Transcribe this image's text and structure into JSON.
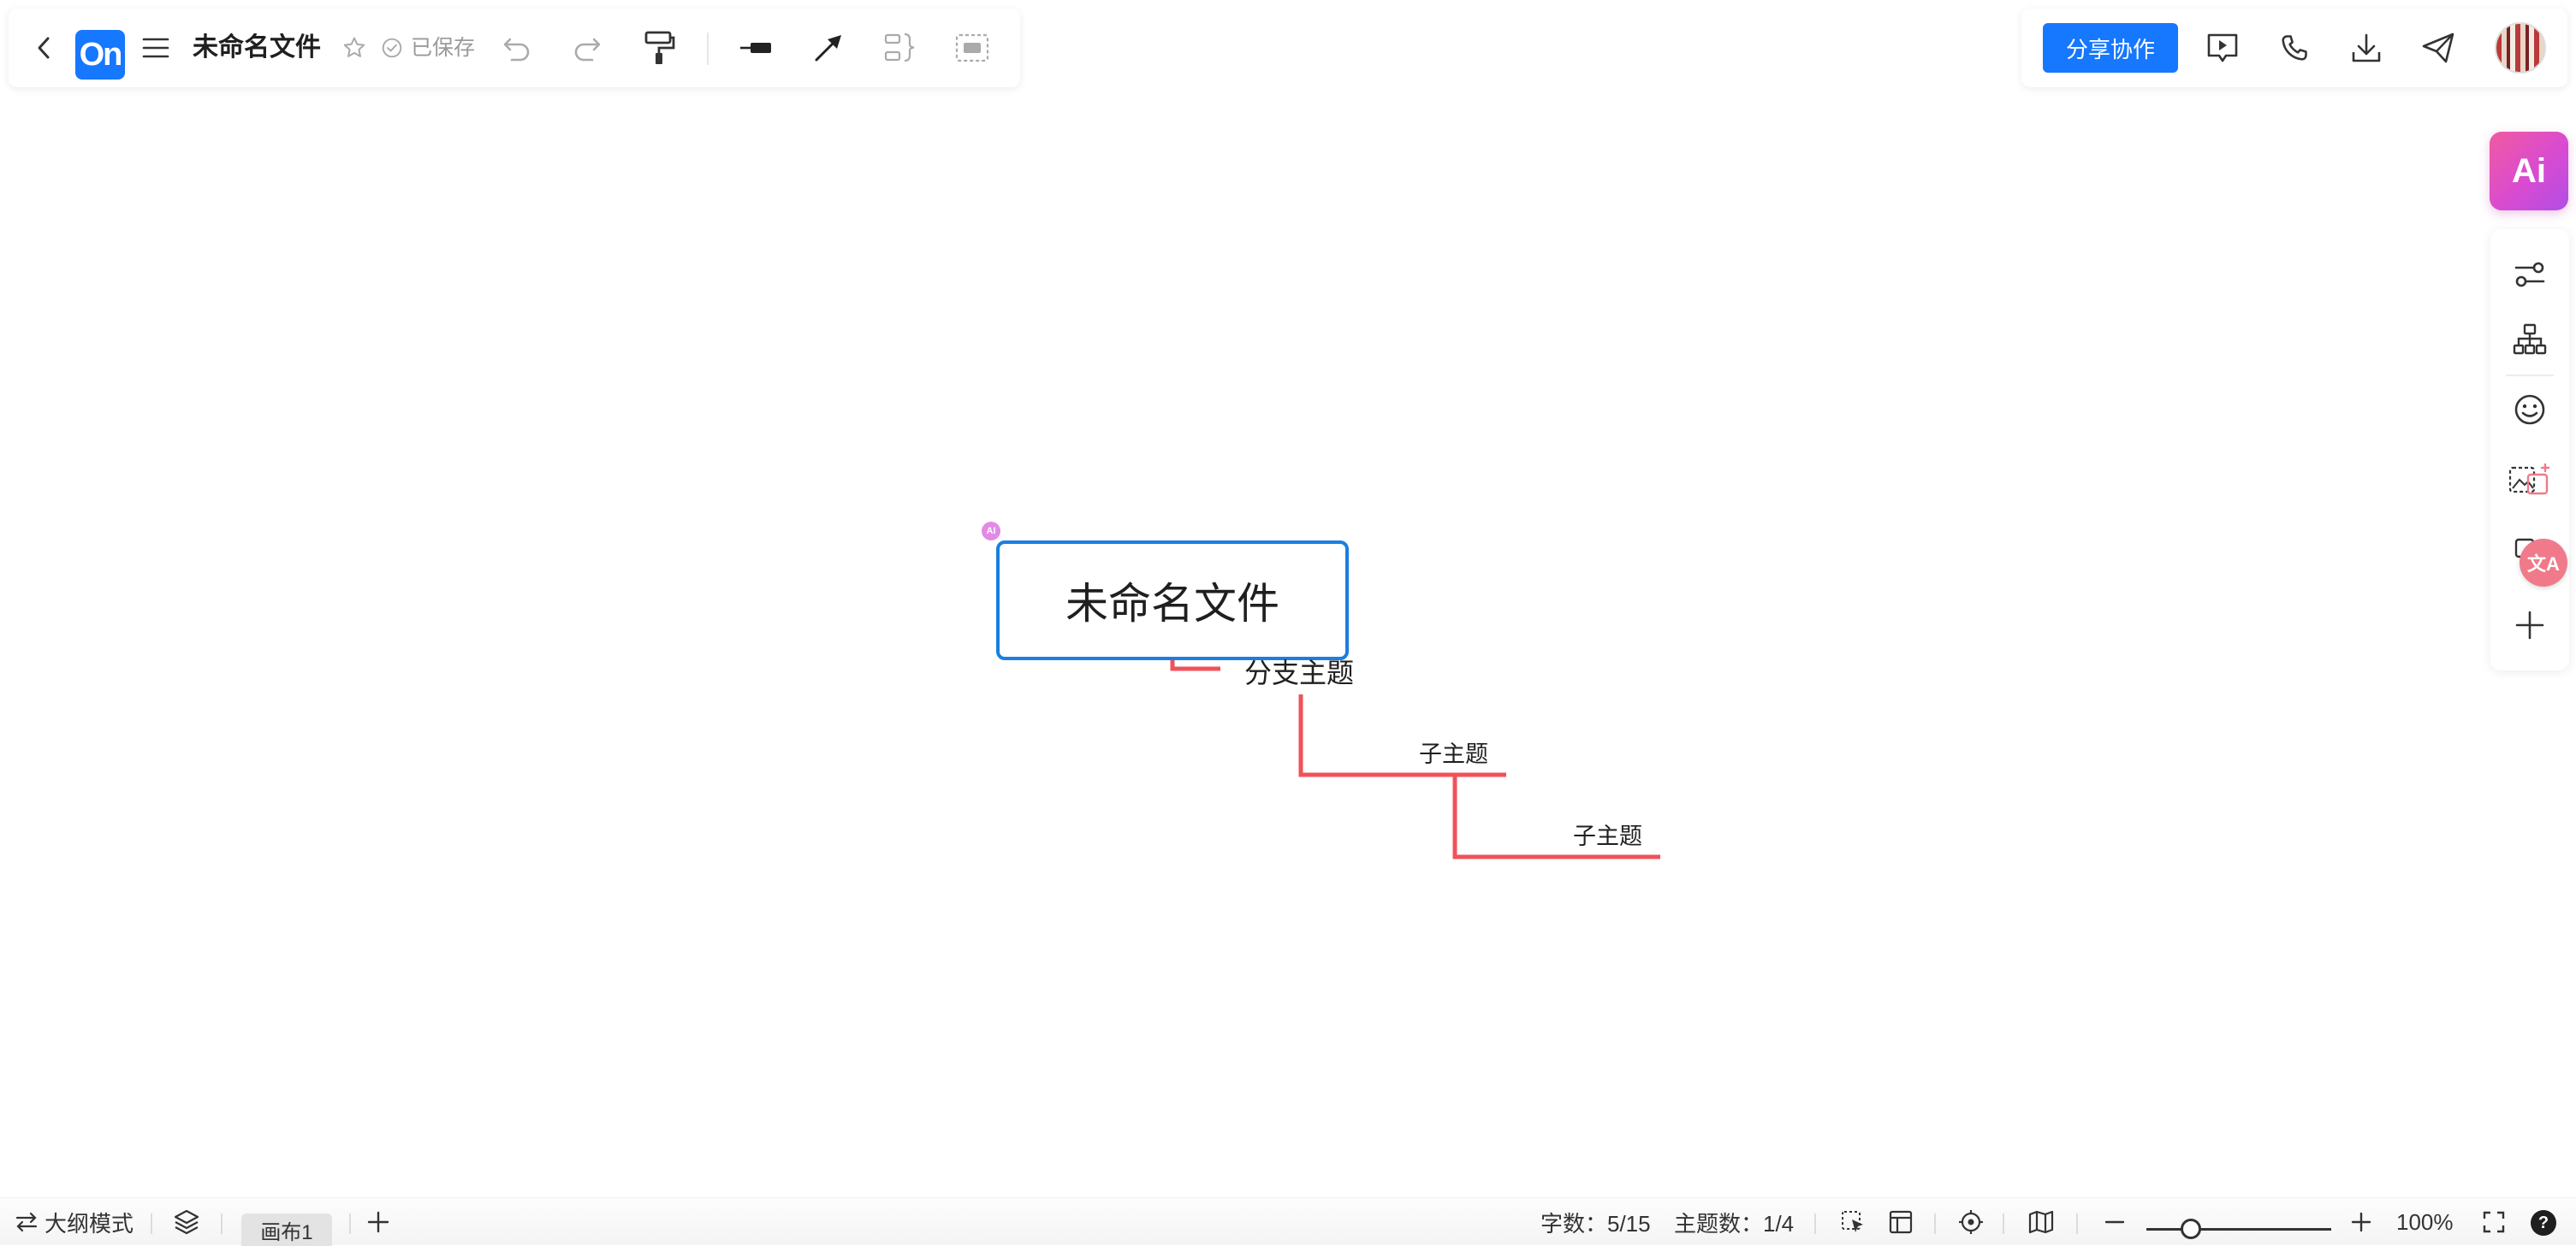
{
  "app": {
    "logo_text": "On"
  },
  "toolbar": {
    "doc_title": "未命名文件",
    "saved_status": "已保存",
    "icons": [
      "back-icon",
      "menu-icon",
      "star-icon",
      "saved-check-icon",
      "undo-icon",
      "redo-icon",
      "format-painter-icon",
      "line-style-icon",
      "arrow-connector-icon",
      "summary-icon",
      "boundary-icon"
    ]
  },
  "header_right": {
    "share_label": "分享协作",
    "icons": [
      "present-icon",
      "call-icon",
      "download-icon",
      "send-icon",
      "avatar"
    ]
  },
  "sidebar": {
    "ai_label": "Ai",
    "translate_badge": "文A",
    "icons": [
      "style-panel-icon",
      "structure-icon",
      "emoji-icon",
      "image-ai-icon",
      "translate-icon",
      "add-icon"
    ]
  },
  "mindmap": {
    "ai_marker": "AI",
    "root": "未命名文件",
    "branch": "分支主题",
    "subtopics": [
      "子主题",
      "子主题"
    ],
    "colors": {
      "root_border": "#1a7fe0",
      "connector": "#f0525a"
    }
  },
  "bottom_bar": {
    "outline_mode": "大纲模式",
    "canvas_tab": "画布1",
    "word_count": "字数：5/15",
    "topic_count": "主题数：1/4",
    "zoom": "100%",
    "help": "?"
  }
}
